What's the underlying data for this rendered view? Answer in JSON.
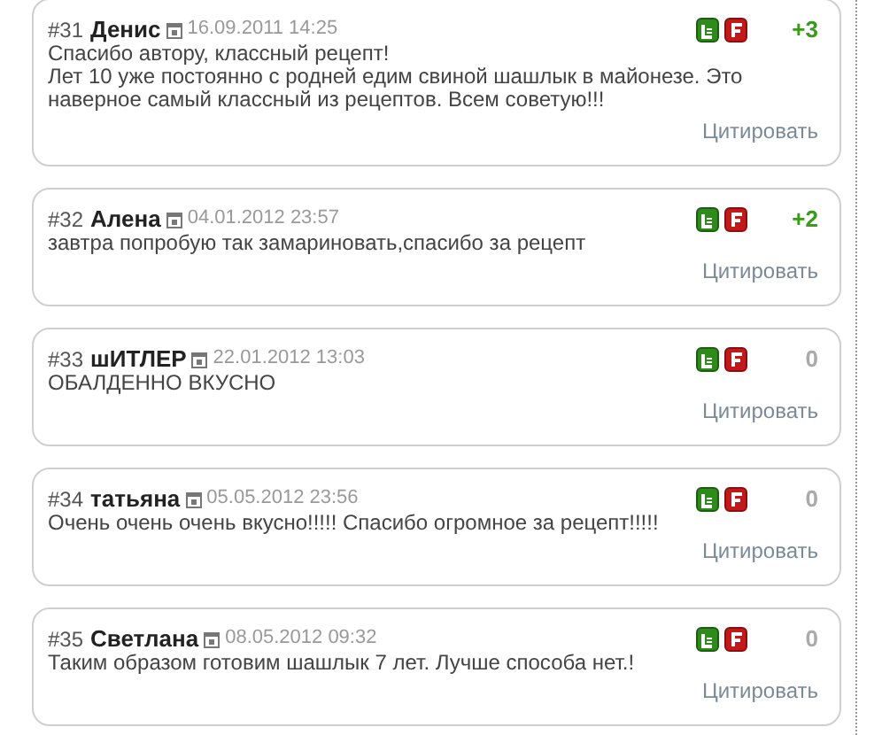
{
  "comments": [
    {
      "number": "#31",
      "author": "Денис",
      "date": "16.09.2011 14:25",
      "lines": [
        "Спасибо автору, классный рецепт!",
        "Лет 10 уже постоянно с родней едим свиной шашлык в майонезе. Это наверное самый классный из рецептов. Всем советую!!!"
      ],
      "score": "+3",
      "color": "#3a9a1a",
      "quote": "Цитировать"
    },
    {
      "number": "#32",
      "author": "Алена",
      "date": "04.01.2012 23:57",
      "lines": [
        "завтра попробую так замариновать,спасибо за рецепт"
      ],
      "score": "+2",
      "color": "#3a9a1a",
      "quote": "Цитировать"
    },
    {
      "number": "#33",
      "author": "шИТЛЕР",
      "date": "22.01.2012 13:03",
      "lines": [
        "ОБАЛДЕННО ВКУСНО"
      ],
      "score": "0",
      "color": "#aaaaaa",
      "quote": "Цитировать"
    },
    {
      "number": "#34",
      "author": "татьяна",
      "date": "05.05.2012 23:56",
      "lines": [
        "Очень очень очень вкусно!!!!! Спасибо огромное за рецепт!!!!!"
      ],
      "score": "0",
      "color": "#aaaaaa",
      "quote": "Цитировать"
    },
    {
      "number": "#35",
      "author": "Светлана",
      "date": "08.05.2012 09:32",
      "lines": [
        "Таким образом готовим шашлык 7 лет. Лучше способа нет.!"
      ],
      "score": "0",
      "color": "#aaaaaa",
      "quote": "Цитировать"
    }
  ]
}
